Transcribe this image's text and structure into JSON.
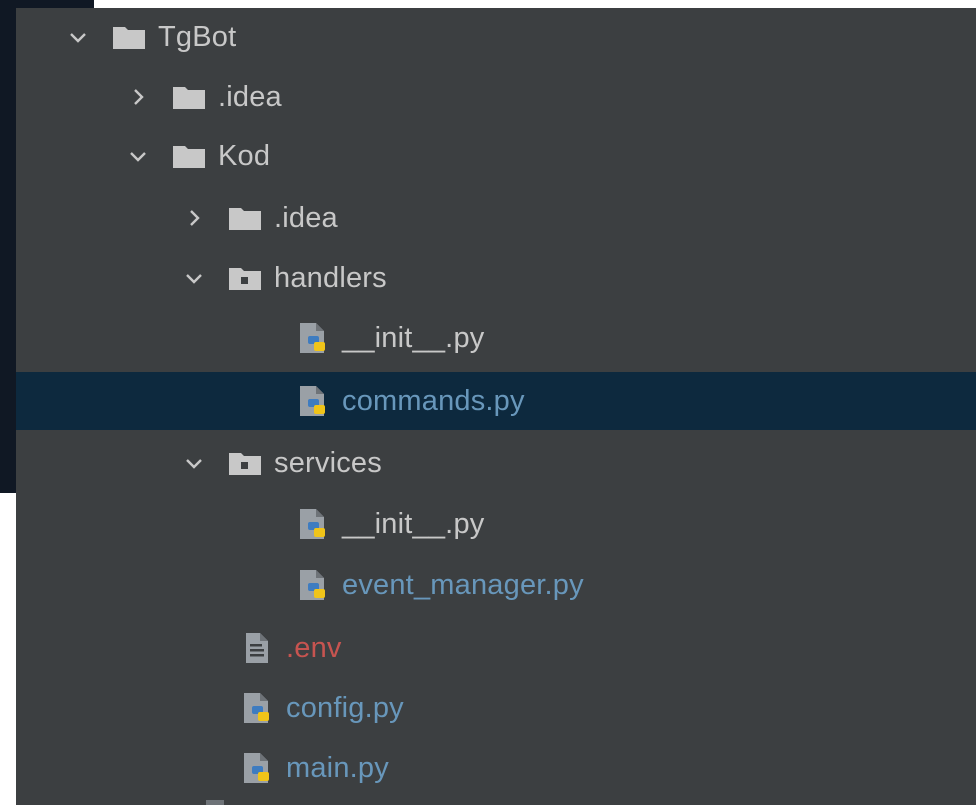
{
  "project_tree": {
    "items": [
      {
        "label": "TgBot",
        "kind": "folder",
        "expanded": true
      },
      {
        "label": ".idea",
        "kind": "folder",
        "expanded": false
      },
      {
        "label": "Kod",
        "kind": "folder",
        "expanded": true
      },
      {
        "label": ".idea",
        "kind": "folder",
        "expanded": false
      },
      {
        "label": "handlers",
        "kind": "package",
        "expanded": true
      },
      {
        "label": "__init__.py",
        "kind": "python-file"
      },
      {
        "label": "commands.py",
        "kind": "python-file",
        "selected": true
      },
      {
        "label": "services",
        "kind": "package",
        "expanded": true
      },
      {
        "label": "__init__.py",
        "kind": "python-file"
      },
      {
        "label": "event_manager.py",
        "kind": "python-file"
      },
      {
        "label": ".env",
        "kind": "text-file"
      },
      {
        "label": "config.py",
        "kind": "python-file"
      },
      {
        "label": "main.py",
        "kind": "python-file"
      }
    ]
  },
  "colors": {
    "panel_bg": "#3c3f41",
    "selection_bg": "#0d293e",
    "default_text": "#c8c8c8",
    "modified_text": "#6897bb",
    "ignored_text": "#c75450",
    "outer_bg": "#101824"
  },
  "icons": {
    "expand_open": "chevron-down-icon",
    "expand_closed": "chevron-right-icon",
    "folder": "folder-icon",
    "package": "package-folder-icon",
    "python": "python-file-icon",
    "text": "text-file-icon"
  }
}
